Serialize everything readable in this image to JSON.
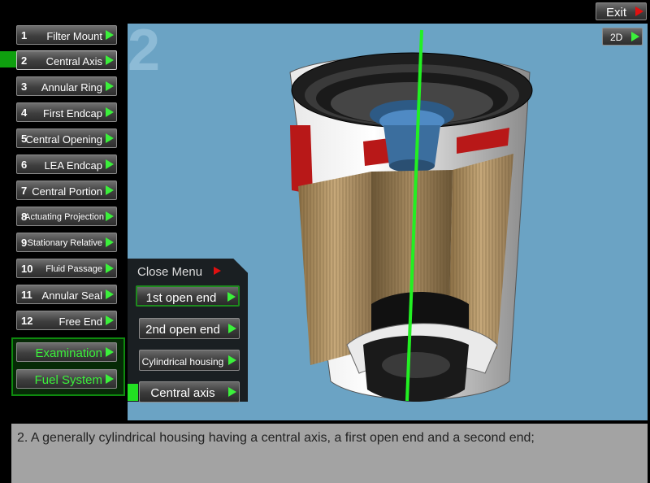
{
  "header": {
    "exit_label": "Exit"
  },
  "viewer": {
    "step_number": "2",
    "toggle_label": "2D"
  },
  "sidebar": {
    "items": [
      {
        "num": "1",
        "label": "Filter Mount"
      },
      {
        "num": "2",
        "label": "Central Axis"
      },
      {
        "num": "3",
        "label": "Annular Ring"
      },
      {
        "num": "4",
        "label": "First Endcap"
      },
      {
        "num": "5",
        "label": "Central Opening"
      },
      {
        "num": "6",
        "label": "LEA Endcap"
      },
      {
        "num": "7",
        "label": "Central  Portion"
      },
      {
        "num": "8",
        "label": "Actuating Projection"
      },
      {
        "num": "9",
        "label": "Stationary Relative"
      },
      {
        "num": "10",
        "label": "Fluid Passage"
      },
      {
        "num": "11",
        "label": "Annular Seal"
      },
      {
        "num": "12",
        "label": "Free End"
      }
    ],
    "selected_index": 1,
    "mode_buttons": [
      {
        "label": "Examination"
      },
      {
        "label": "Fuel System"
      }
    ]
  },
  "submenu": {
    "close_label": "Close Menu",
    "items": [
      {
        "label": "1st open end"
      },
      {
        "label": "2nd open end"
      },
      {
        "label": "Cylindrical housing"
      },
      {
        "label": "Central axis"
      }
    ],
    "selected_index": 3
  },
  "description": {
    "text": "2. A generally cylindrical housing having a central axis, a first open end and a second end;"
  },
  "colors": {
    "viewer_bg": "#6ba3c4",
    "accent_green": "#3bf03b",
    "alert_red": "#e01010",
    "panel_bg": "#a3a3a3"
  }
}
